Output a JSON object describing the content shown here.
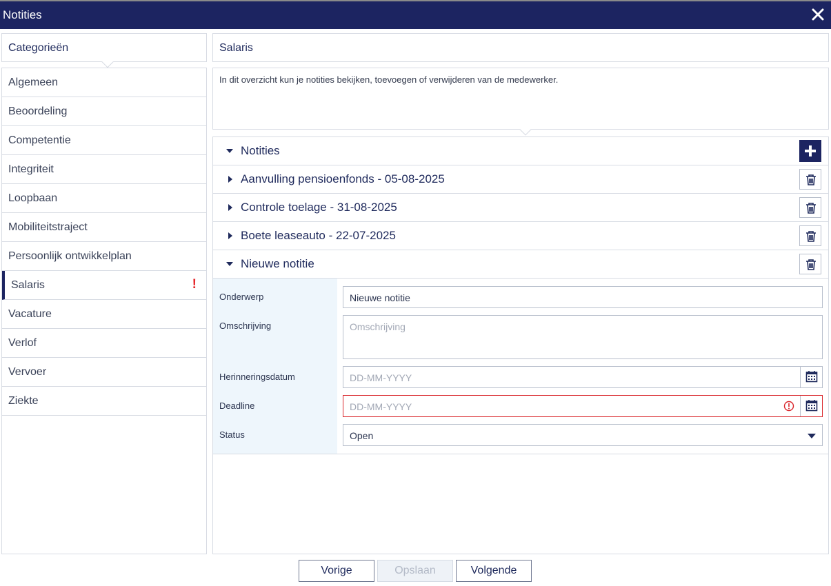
{
  "window": {
    "title": "Notities"
  },
  "colors": {
    "header_bg": "#1c2461",
    "accent": "#1c2461",
    "error": "#d9262b",
    "label_bg": "#eef6fc"
  },
  "categories": {
    "header": "Categorieën",
    "items": [
      {
        "label": "Algemeen"
      },
      {
        "label": "Beoordeling"
      },
      {
        "label": "Competentie"
      },
      {
        "label": "Integriteit"
      },
      {
        "label": "Loopbaan"
      },
      {
        "label": "Mobiliteitstraject"
      },
      {
        "label": "Persoonlijk ontwikkelplan"
      },
      {
        "label": "Salaris",
        "active": true,
        "warning": "!"
      },
      {
        "label": "Vacature"
      },
      {
        "label": "Verlof"
      },
      {
        "label": "Vervoer"
      },
      {
        "label": "Ziekte"
      }
    ]
  },
  "section": {
    "title": "Salaris",
    "description": "In dit overzicht kun je notities bekijken, toevoegen of verwijderen van de medewerker."
  },
  "notes": {
    "header": "Notities",
    "items": [
      {
        "title": "Aanvulling pensioenfonds - 05-08-2025",
        "expanded": false
      },
      {
        "title": "Controle toelage - 31-08-2025",
        "expanded": false
      },
      {
        "title": "Boete leaseauto - 22-07-2025",
        "expanded": false
      },
      {
        "title": "Nieuwe notitie",
        "expanded": true
      }
    ]
  },
  "form": {
    "subject": {
      "label": "Onderwerp",
      "value": "Nieuwe notitie"
    },
    "description": {
      "label": "Omschrijving",
      "placeholder": "Omschrijving"
    },
    "reminder": {
      "label": "Herinneringsdatum",
      "placeholder": "DD-MM-YYYY"
    },
    "deadline": {
      "label": "Deadline",
      "placeholder": "DD-MM-YYYY",
      "error": true
    },
    "status": {
      "label": "Status",
      "value": "Open"
    }
  },
  "footer": {
    "prev_label": "Vorige",
    "save_label": "Opslaan",
    "next_label": "Volgende"
  }
}
